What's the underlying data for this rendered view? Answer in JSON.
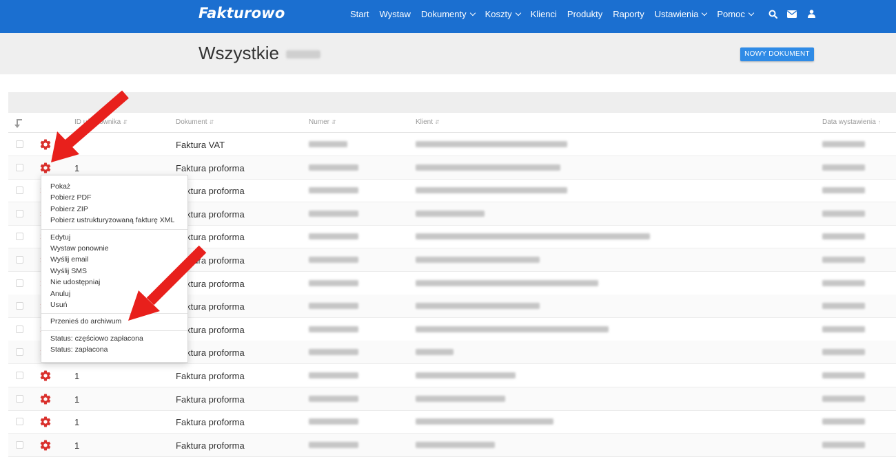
{
  "topbar": {
    "logo": "Fakturowo",
    "nav": [
      {
        "label": "Start",
        "dropdown": false
      },
      {
        "label": "Wystaw",
        "dropdown": false
      },
      {
        "label": "Dokumenty",
        "dropdown": true
      },
      {
        "label": "Koszty",
        "dropdown": true
      },
      {
        "label": "Klienci",
        "dropdown": false
      },
      {
        "label": "Produkty",
        "dropdown": false
      },
      {
        "label": "Raporty",
        "dropdown": false
      },
      {
        "label": "Ustawienia",
        "dropdown": true
      },
      {
        "label": "Pomoc",
        "dropdown": true
      }
    ],
    "icons": [
      "search-icon",
      "envelope-icon",
      "user-icon"
    ],
    "color": "#1b6fd0"
  },
  "page": {
    "title": "Wszystkie",
    "new_document_button": "NOWY DOKUMENT"
  },
  "table": {
    "columns": {
      "id": "ID użytkownika",
      "document": "Dokument",
      "number": "Numer",
      "client": "Klient",
      "date": "Data wystawienia"
    },
    "rows": [
      {
        "id": "",
        "document": "Faktura VAT"
      },
      {
        "id": "1",
        "document": "Faktura proforma"
      },
      {
        "id": "",
        "document": "Faktura proforma"
      },
      {
        "id": "",
        "document": "Faktura proforma"
      },
      {
        "id": "",
        "document": "Faktura proforma"
      },
      {
        "id": "",
        "document": "Faktura proforma"
      },
      {
        "id": "",
        "document": "Faktura proforma"
      },
      {
        "id": "",
        "document": "Faktura proforma"
      },
      {
        "id": "",
        "document": "Faktura proforma"
      },
      {
        "id": "",
        "document": "Faktura proforma"
      },
      {
        "id": "1",
        "document": "Faktura proforma"
      },
      {
        "id": "1",
        "document": "Faktura proforma"
      },
      {
        "id": "1",
        "document": "Faktura proforma"
      },
      {
        "id": "1",
        "document": "Faktura proforma"
      }
    ]
  },
  "action_menu": {
    "groups": [
      [
        "Pokaż",
        "Pobierz PDF",
        "Pobierz ZIP",
        "Pobierz ustrukturyzowaną fakturę XML"
      ],
      [
        "Edytuj",
        "Wystaw ponownie",
        "Wyślij email",
        "Wyślij SMS",
        "Nie udostępniaj",
        "Anuluj",
        "Usuń"
      ],
      [
        "Przenieś do archiwum"
      ],
      [
        "Status: częściowo zapłacona",
        "Status: zapłacona"
      ]
    ]
  },
  "colors": {
    "accent": "#1b6fd0",
    "button": "#2f8be6",
    "gear": "#d9302c",
    "annotation_arrow": "#e8201c"
  }
}
